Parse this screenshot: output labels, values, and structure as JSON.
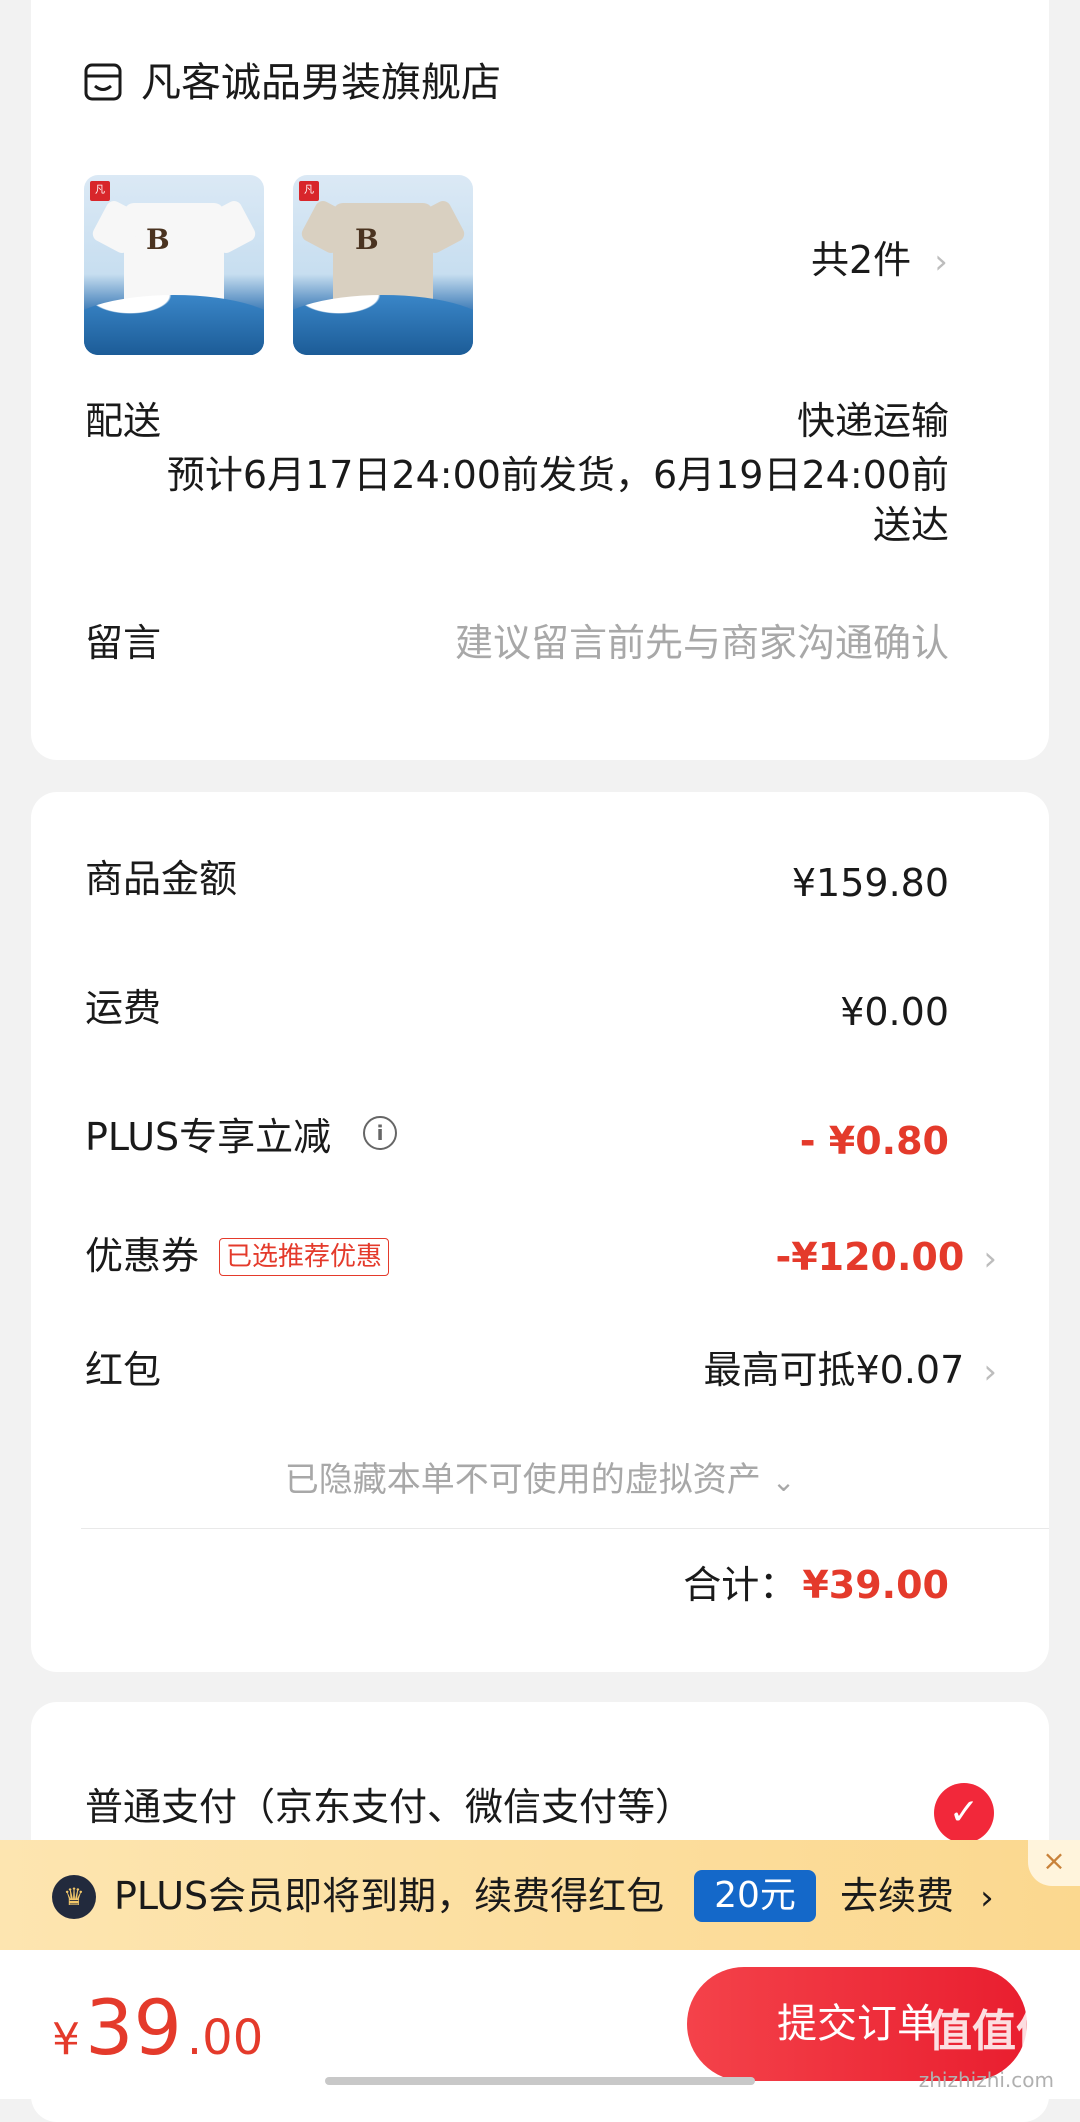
{
  "shop": {
    "name": "凡客诚品男装旗舰店",
    "icon": "store-icon",
    "item_count_label": "共2件",
    "products": [
      {
        "icon": "white-tshirt-image",
        "color": "#f7f7f7"
      },
      {
        "icon": "beige-tshirt-image",
        "color": "#d9d0c1"
      }
    ],
    "delivery": {
      "label": "配送",
      "method": "快递运输",
      "eta_line1": "预计6月17日24:00前发货，6月19日24:00前",
      "eta_line2": "送达"
    },
    "message": {
      "label": "留言",
      "placeholder": "建议留言前先与商家沟通确认"
    }
  },
  "price": {
    "goods_label": "商品金额",
    "goods_value": "¥159.80",
    "shipping_label": "运费",
    "shipping_value": "¥0.00",
    "plus_label": "PLUS专享立减",
    "plus_value": "- ¥0.80",
    "coupon_label": "优惠券",
    "coupon_tag": "已选推荐优惠",
    "coupon_value": "-¥120.00",
    "redpacket_label": "红包",
    "redpacket_value": "最高可抵¥0.07",
    "hidden_assets": "已隐藏本单不可使用的虚拟资产",
    "total_label": "合计：",
    "total_value": "¥39.00"
  },
  "payment": {
    "option_label": "普通支付（京东支付、微信支付等）",
    "selected": true
  },
  "plus_banner": {
    "text": "PLUS会员即将到期，续费得红包",
    "amount": "20元",
    "action": "去续费"
  },
  "footer": {
    "currency": "¥",
    "amount_int": "39",
    "amount_dec": ".00",
    "submit_label": "提交订单"
  },
  "watermark": {
    "text": "值值值",
    "url": "zhizhizhi.com"
  },
  "colors": {
    "accent_red": "#e43a2b",
    "plus_blue": "#1468c9"
  }
}
